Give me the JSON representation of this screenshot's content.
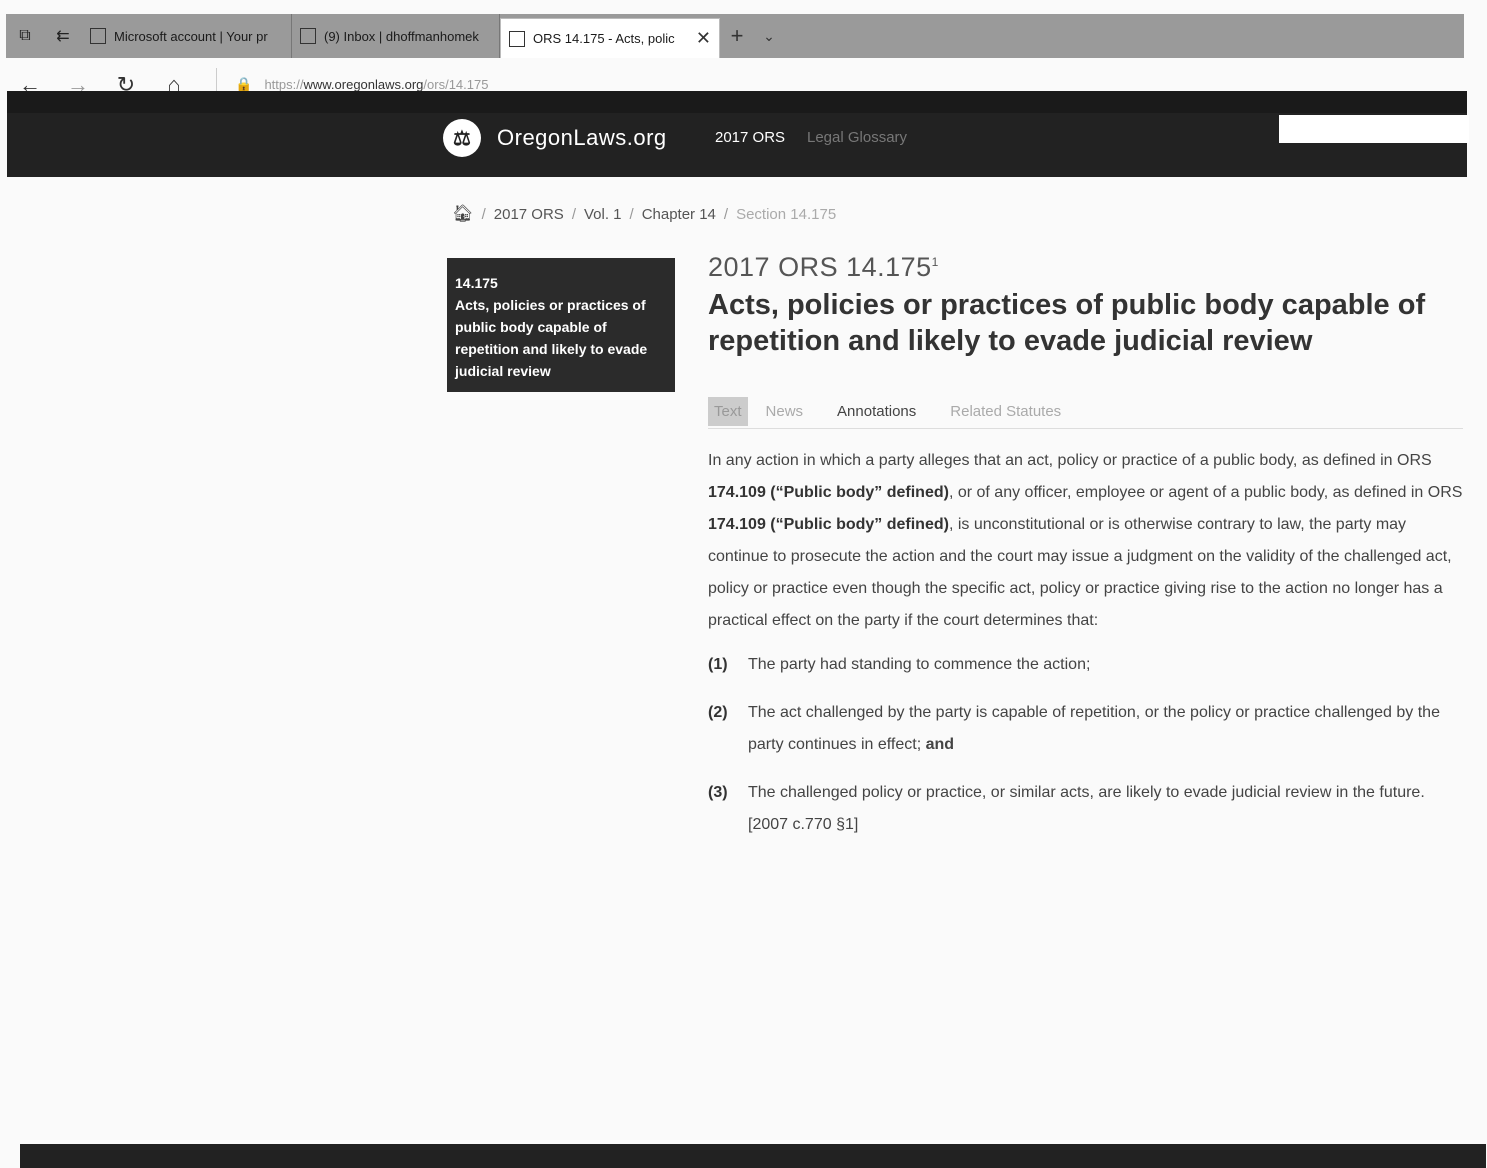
{
  "browser": {
    "tabs": [
      {
        "label": "Microsoft account | Your pr"
      },
      {
        "label": "(9) Inbox | dhoffmanhomek"
      },
      {
        "label": "ORS 14.175 - Acts, polic"
      }
    ],
    "url_prefix": "https://",
    "url_host": "www.oregonlaws.org",
    "url_path": "/ors/14.175"
  },
  "site": {
    "brand": "OregonLaws.org",
    "nav_ors": "2017 ORS",
    "nav_glossary": "Legal Glossary"
  },
  "breadcrumb": {
    "items": [
      "2017 ORS",
      "Vol. 1",
      "Chapter 14"
    ],
    "current": "Section 14.175"
  },
  "sidebar": {
    "number": "14.175",
    "title": "Acts, policies or practices of public body capable of repetition and likely to evade judicial review"
  },
  "main": {
    "ors_number": "2017 ORS 14.175",
    "footnote_mark": "1",
    "title": "Acts, policies or practices of public body capable of repetition and likely to evade judicial review",
    "tabs": [
      "Text",
      "News",
      "Annotations",
      "Related Statutes"
    ],
    "body_1": "In any action in which a party alleges that an act, policy or practice of a public body, as defined in ORS ",
    "link_1": "174.109 (“Public body” defined)",
    "body_2": ", or of any officer, employee or agent of a public body, as defined in ORS ",
    "link_2": "174.109 (“Public body” defined)",
    "body_3": ", is unconstitutional or is otherwise contrary to law, the party may continue to prosecute the action and the court may issue a judgment on the validity of the challenged act, policy or practice even though the specific act, policy or practice giving rise to the action no longer has a practical effect on the party if the court determines that:",
    "items": [
      {
        "num": "(1)",
        "text": "The party had standing to commence the action;"
      },
      {
        "num": "(2)",
        "text": "The act challenged by the party is capable of repetition, or the policy or practice challenged by the party continues in effect;",
        "tail": "and"
      },
      {
        "num": "(3)",
        "text": "The challenged policy or practice, or similar acts, are likely to evade judicial review in the future. [2007 c.770 §1]"
      }
    ]
  }
}
